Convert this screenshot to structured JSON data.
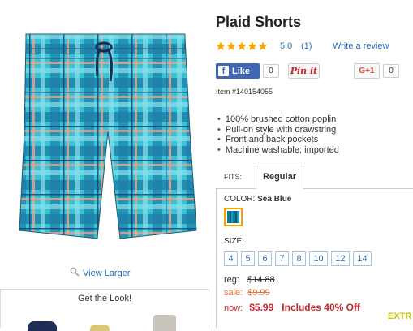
{
  "product": {
    "title": "Plaid Shorts",
    "rating": "5.0",
    "review_count": "(1)",
    "write_review": "Write a review",
    "item_number": "Item #140154055",
    "features": [
      "100% brushed cotton poplin",
      "Pull-on style with drawstring",
      "Front and back pockets",
      "Machine washable; imported"
    ]
  },
  "media": {
    "view_larger": "View Larger",
    "get_the_look": "Get the Look!"
  },
  "social": {
    "fb_label": "Like",
    "fb_count": "0",
    "pin_label": "Pin it",
    "gplus_label": "G+1",
    "gplus_count": "0"
  },
  "fits": {
    "label": "FITS:",
    "selected": "Regular"
  },
  "color": {
    "label": "COLOR:",
    "value": "Sea Blue",
    "swatch_hex": "#2fb3c6"
  },
  "sizes": {
    "label": "SIZE:",
    "options": [
      "4",
      "5",
      "6",
      "7",
      "8",
      "10",
      "12",
      "14"
    ]
  },
  "pricing": {
    "reg_label": "reg:",
    "reg_price": "$14.88",
    "sale_label": "sale:",
    "sale_price": "$9.99",
    "now_label": "now:",
    "now_price": "$5.99",
    "promo": "Includes 40% Off",
    "extra": "EXTR"
  },
  "colors": {
    "link": "#2a6ebb",
    "sale": "#e8753a",
    "now": "#c0282e",
    "swatch_border": "#f0a400",
    "star": "#f7a600"
  }
}
